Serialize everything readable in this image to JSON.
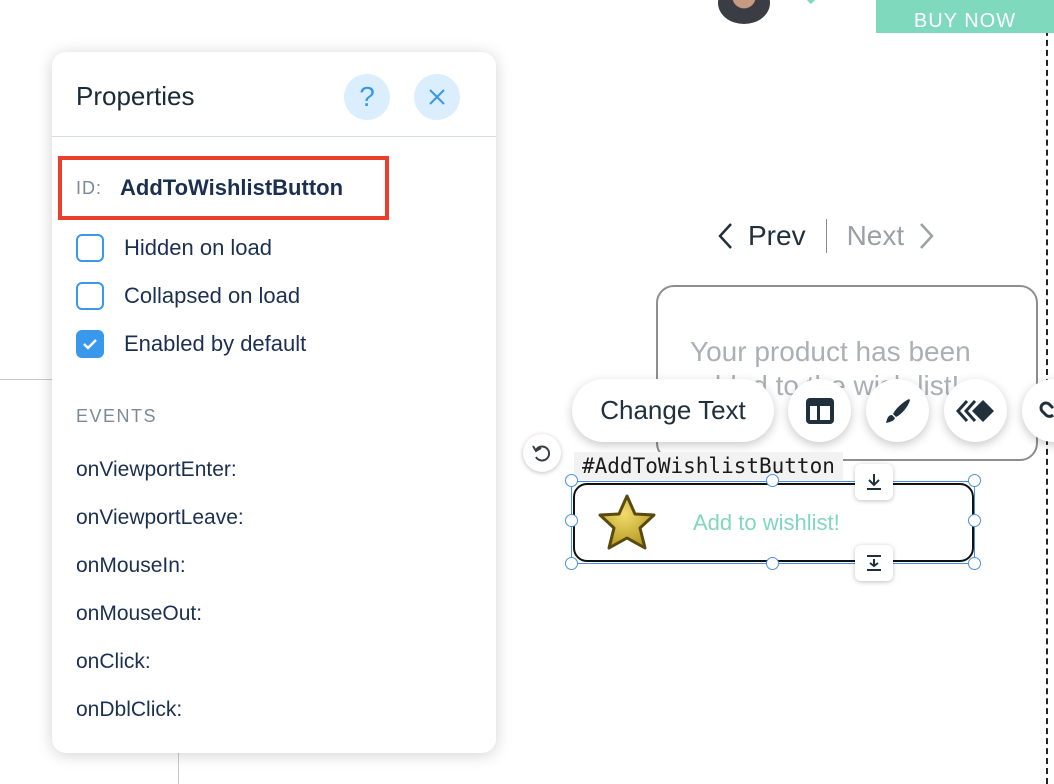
{
  "topbar": {
    "buy_now_label": "BUY NOW"
  },
  "pager": {
    "prev_label": "Prev",
    "next_label": "Next"
  },
  "notification": {
    "text": "Your product has been added to the wish list!"
  },
  "toolbar": {
    "change_text_label": "Change Text"
  },
  "element": {
    "id_tag": "#AddToWishlistButton",
    "button_label": "Add to wishlist!"
  },
  "panel": {
    "title": "Properties",
    "help_glyph": "?",
    "id_label": "ID:",
    "id_value": "AddToWishlistButton",
    "options": [
      {
        "label": "Hidden on load",
        "checked": false
      },
      {
        "label": "Collapsed on load",
        "checked": false
      },
      {
        "label": "Enabled by default",
        "checked": true
      }
    ],
    "events_title": "EVENTS",
    "events": [
      "onViewportEnter:",
      "onViewportLeave:",
      "onMouseIn:",
      "onMouseOut:",
      "onClick:",
      "onDblClick:"
    ]
  },
  "colors": {
    "accent": "#3899ec",
    "highlight": "#e8402c",
    "brand_green": "#7ed9bd",
    "star": "#d9bf3a"
  },
  "icons": [
    "help-icon",
    "close-icon",
    "chevron-left-icon",
    "chevron-right-icon",
    "layout-icon",
    "design-brush-icon",
    "animation-icon",
    "link-icon",
    "undo-icon",
    "download-icon",
    "stretch-icon",
    "star-icon",
    "checkmark-icon"
  ]
}
